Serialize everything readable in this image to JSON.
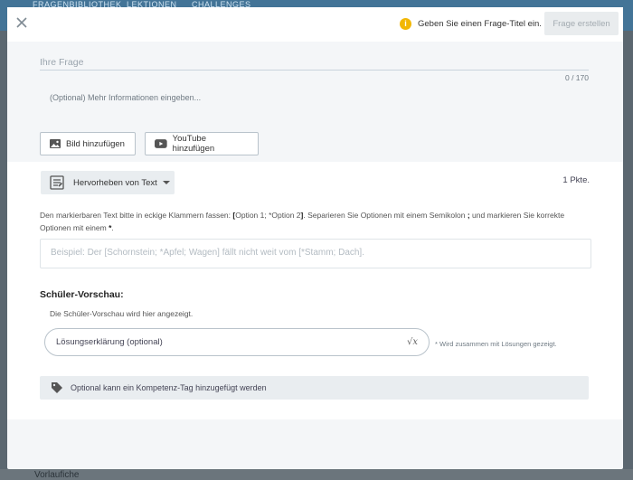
{
  "background": {
    "nav_items": [
      "FRAGENBIBLIOTHEK",
      "LEKTIONEN",
      "CHALLENGES"
    ],
    "bottom_text": "Vorlaufiche"
  },
  "header": {
    "warning_text": "Geben Sie einen Frage-Titel ein.",
    "create_button_label": "Frage erstellen"
  },
  "question": {
    "placeholder": "Ihre Frage",
    "value": "",
    "counter": "0 / 170",
    "info_placeholder": "(Optional) Mehr Informationen eingeben..."
  },
  "media": {
    "image_button_label": "Bild hinzufügen",
    "youtube_button_label": "YouTube hinzufügen"
  },
  "question_type": {
    "selected": "Hervorheben von Text",
    "points": "1 Pkte."
  },
  "instructions": {
    "part1": "Den markierbaren Text bitte in eckige Klammern fassen: ",
    "bracket_open": "[",
    "example_options": "Option 1; *Option 2",
    "bracket_close": "]",
    "part2": ". Separieren Sie Optionen mit einem Semikolon ",
    "semicolon": ";",
    "part3": " und markieren Sie korrekte Optionen mit einem ",
    "asterisk": "*",
    "part4": "."
  },
  "example": {
    "placeholder": "Beispiel: Der [Schornstein; *Apfel; Wagen] fällt nicht weit vom [*Stamm; Dach]."
  },
  "preview": {
    "title": "Schüler-Vorschau:",
    "text": "Die Schüler-Vorschau wird hier angezeigt."
  },
  "solution": {
    "placeholder": "Lösungserklärung (optional)",
    "note": "* Wird zusammen mit Lösungen gezeigt."
  },
  "tags": {
    "label": "Optional kann ein Kompetenz-Tag hinzugefügt werden"
  },
  "colors": {
    "warning": "#f2b705",
    "accent": "#2f7fb8",
    "youtube": "#555555"
  },
  "icons": {
    "close": "close-icon",
    "warning": "info-icon",
    "image": "image-icon",
    "youtube": "youtube-icon",
    "question_type": "highlight-text-icon",
    "formula": "sqrt-icon",
    "tag": "tag-icon"
  }
}
